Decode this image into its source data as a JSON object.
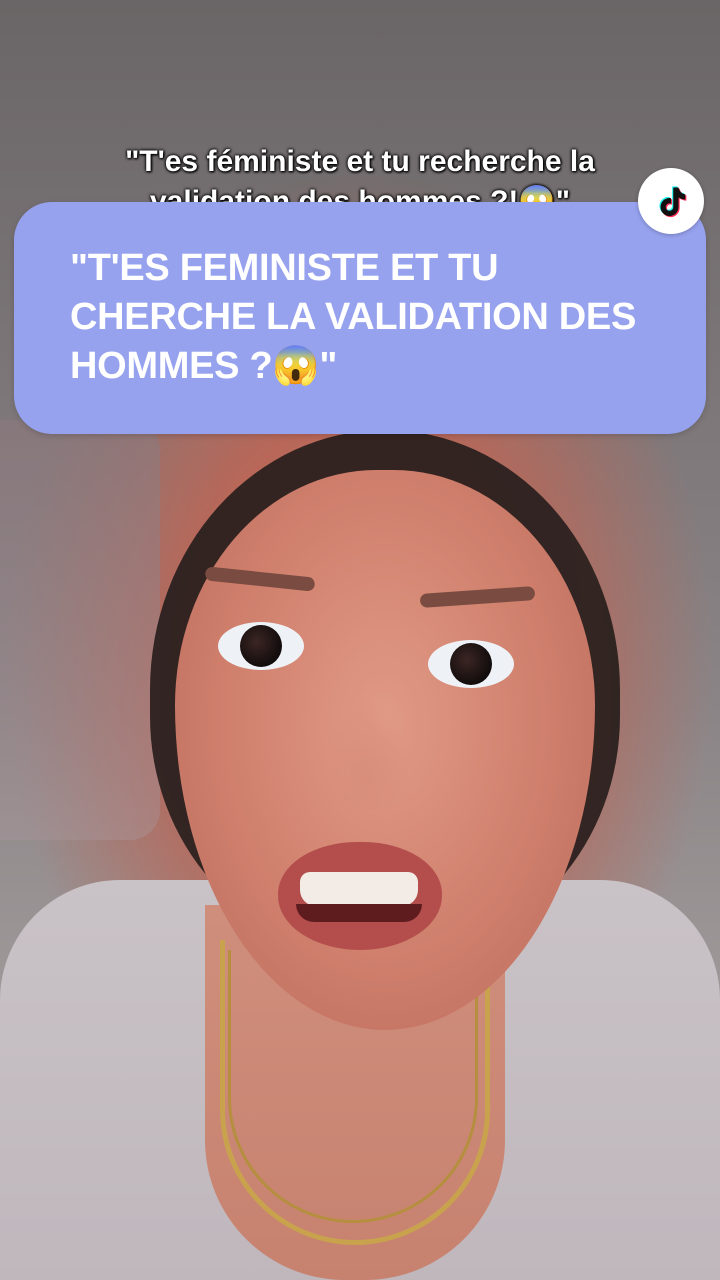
{
  "video": {
    "subject": "woman-speaking-to-camera"
  },
  "caption": {
    "line1": "\"T'es féministe et tu recherche la",
    "line2": "validation des hommes ?!😱\""
  },
  "question_card": {
    "text": "\"T'ES FEMINISTE ET TU CHERCHE LA VALIDATION DES HOMMES ?😱\"",
    "background": "#97a2ef",
    "text_color": "#ffffff"
  },
  "badge": {
    "icon": "tiktok-logo-icon"
  }
}
